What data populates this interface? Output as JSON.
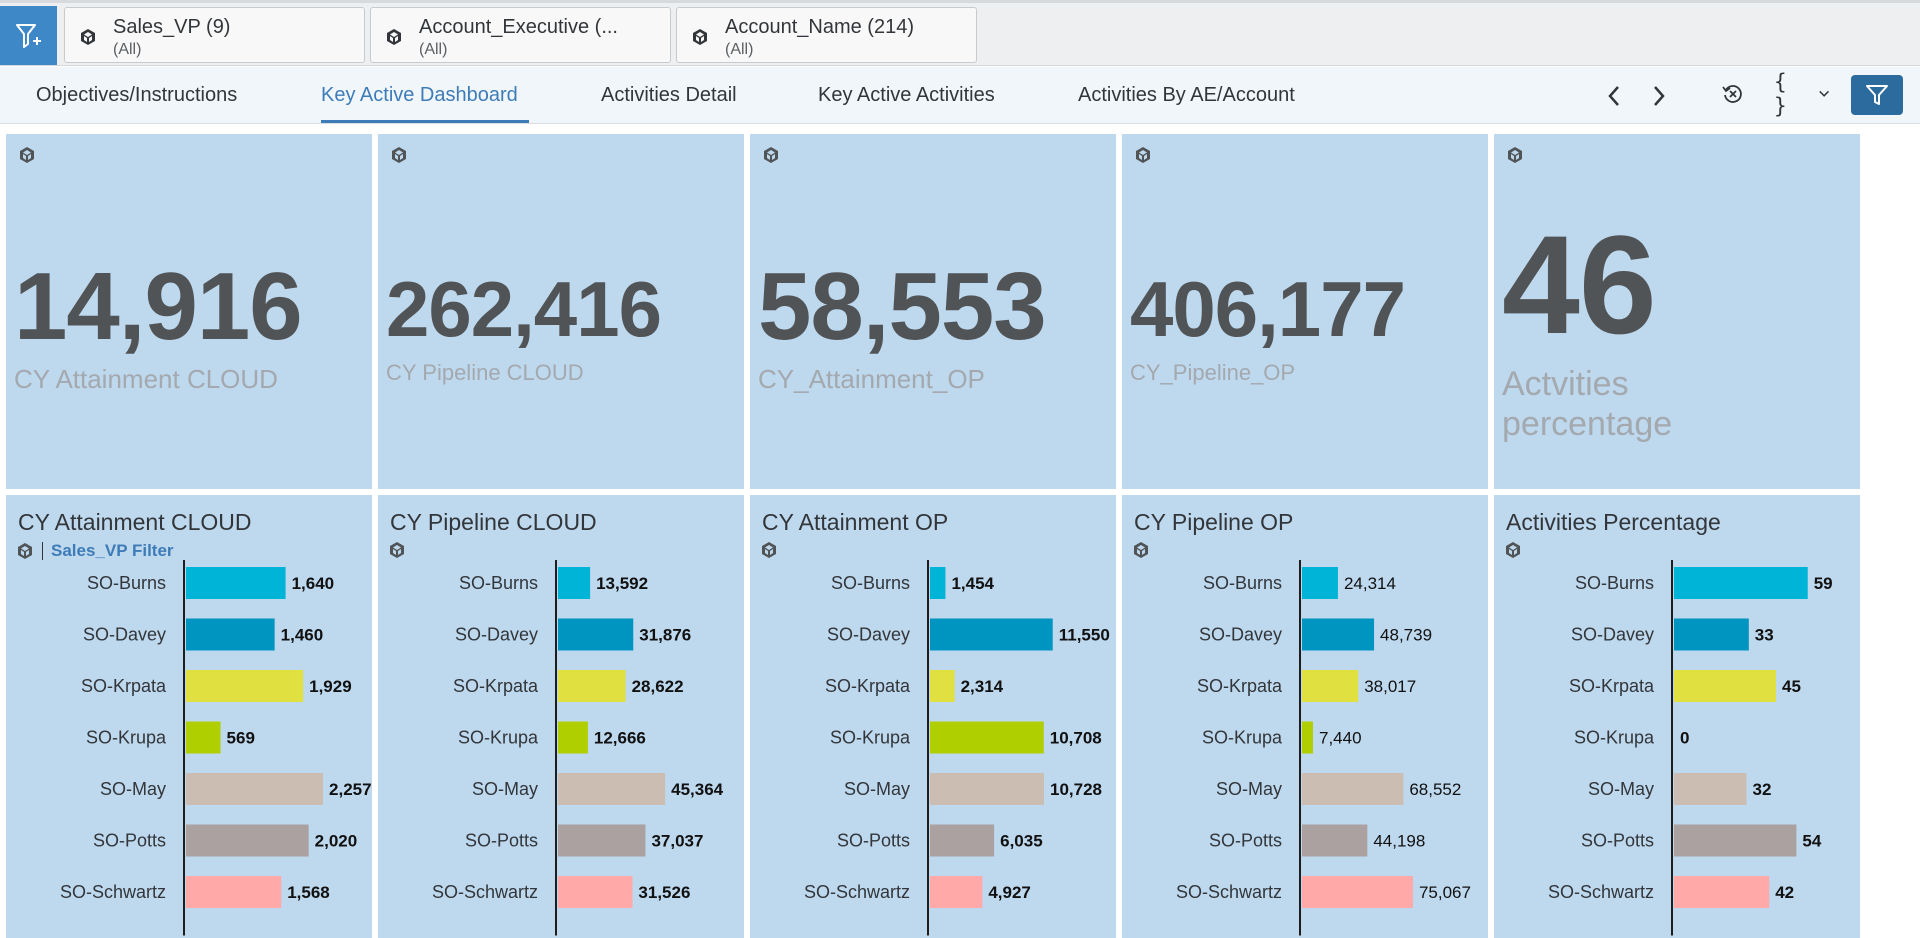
{
  "filters": [
    {
      "title": "Sales_VP (9)",
      "value": "(All)"
    },
    {
      "title": "Account_Executive (...",
      "value": "(All)"
    },
    {
      "title": "Account_Name (214)",
      "value": "(All)"
    }
  ],
  "tabs": [
    {
      "label": "Objectives/Instructions"
    },
    {
      "label": "Key Active Dashboard"
    },
    {
      "label": "Activities Detail"
    },
    {
      "label": "Key Active Activities"
    },
    {
      "label": "Activities By AE/Account"
    }
  ],
  "toolbar": {
    "variables_label": "{ }"
  },
  "kpis": [
    {
      "value": "14,916",
      "label": "CY Attainment CLOUD"
    },
    {
      "value": "262,416",
      "label": "CY Pipeline CLOUD"
    },
    {
      "value": "58,553",
      "label": "CY_Attainment_OP"
    },
    {
      "value": "406,177",
      "label": "CY_Pipeline_OP"
    },
    {
      "value": "46",
      "label_line1": "Actvities",
      "label_line2": "percentage"
    }
  ],
  "charts": [
    {
      "title": "CY Attainment CLOUD",
      "filter_link": "Sales_VP Filter"
    },
    {
      "title": "CY Pipeline CLOUD"
    },
    {
      "title": "CY Attainment OP"
    },
    {
      "title": "CY Pipeline OP"
    },
    {
      "title": "Activities Percentage"
    }
  ],
  "series_colors": [
    "#00b4d8",
    "#0095c0",
    "#e0e040",
    "#b0cf00",
    "#cbbdb1",
    "#aaa1a0",
    "#ffa9a8"
  ],
  "chart_data": [
    {
      "type": "bar",
      "title": "CY Attainment CLOUD",
      "orientation": "horizontal",
      "categories": [
        "SO-Burns",
        "SO-Davey",
        "SO-Krpata",
        "SO-Krupa",
        "SO-May",
        "SO-Potts",
        "SO-Schwartz"
      ],
      "values": [
        1640,
        1460,
        1929,
        569,
        2257,
        2020,
        1568
      ],
      "value_labels": [
        "1,640",
        "1,460",
        "1,929",
        "569",
        "2,257",
        "2,020",
        "1,568"
      ],
      "xlim": [
        0,
        2800
      ]
    },
    {
      "type": "bar",
      "title": "CY Pipeline CLOUD",
      "orientation": "horizontal",
      "categories": [
        "SO-Burns",
        "SO-Davey",
        "SO-Krpata",
        "SO-Krupa",
        "SO-May",
        "SO-Potts",
        "SO-Schwartz"
      ],
      "values": [
        13592,
        31876,
        28622,
        12666,
        45364,
        37037,
        31526
      ],
      "value_labels": [
        "13,592",
        "31,876",
        "28,622",
        "12,666",
        "45,364",
        "37,037",
        "31,526"
      ],
      "xlim": [
        0,
        72000
      ]
    },
    {
      "type": "bar",
      "title": "CY Attainment OP",
      "orientation": "horizontal",
      "categories": [
        "SO-Burns",
        "SO-Davey",
        "SO-Krpata",
        "SO-Krupa",
        "SO-May",
        "SO-Potts",
        "SO-Schwartz"
      ],
      "values": [
        1454,
        11550,
        2314,
        10708,
        10728,
        6035,
        4927
      ],
      "value_labels": [
        "1,454",
        "11,550",
        "2,314",
        "10,708",
        "10,728",
        "6,035",
        "4,927"
      ],
      "xlim": [
        0,
        16000
      ]
    },
    {
      "type": "bar",
      "title": "CY Pipeline OP",
      "orientation": "horizontal",
      "categories": [
        "SO-Burns",
        "SO-Davey",
        "SO-Krpata",
        "SO-Krupa",
        "SO-May",
        "SO-Potts",
        "SO-Schwartz"
      ],
      "values": [
        24314,
        48739,
        38017,
        7440,
        68552,
        44198,
        75067
      ],
      "value_labels": [
        "24,314",
        "48,739",
        "38,017",
        "7,440",
        "68,552",
        "44,198",
        "75,067"
      ],
      "xlim": [
        0,
        115000
      ],
      "bold_labels": false
    },
    {
      "type": "bar",
      "title": "Activities Percentage",
      "orientation": "horizontal",
      "categories": [
        "SO-Burns",
        "SO-Davey",
        "SO-Krpata",
        "SO-Krupa",
        "SO-May",
        "SO-Potts",
        "SO-Schwartz"
      ],
      "values": [
        59,
        33,
        45,
        0,
        32,
        54,
        42
      ],
      "value_labels": [
        "59",
        "33",
        "45",
        "0",
        "32",
        "54",
        "42"
      ],
      "xlim": [
        0,
        75
      ]
    }
  ]
}
